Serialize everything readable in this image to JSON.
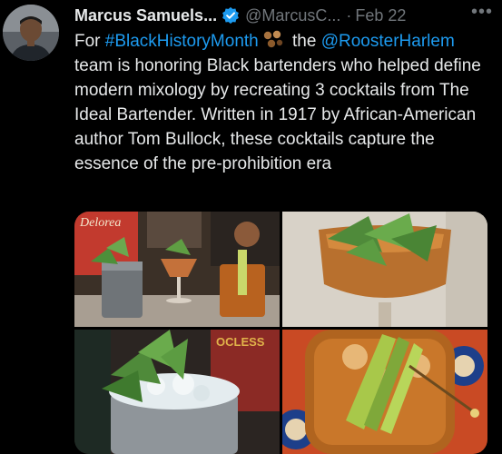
{
  "author": {
    "name": "Marcus Samuels...",
    "handle": "@MarcusC...",
    "separator": "·",
    "date": "Feb 22",
    "more_icon": "more-icon",
    "verified_icon": "verified-icon"
  },
  "tweet": {
    "part1": "For ",
    "hashtag": "#BlackHistoryMonth",
    "emoji": "cocktail-emoji",
    "part2": " the ",
    "mention": "@RoosterHarlem",
    "part3": " team is honoring Black bartenders who helped define modern mixology by recreating 3 cocktails from The Ideal Bartender. Written in 1917 by African-American author Tom Bullock, these cocktails capture the essence of the pre-prohibition era"
  },
  "media": {
    "tile1_sign_text": "Delorea",
    "tile3_sign_text": "OCLESS",
    "colors": {
      "link": "#1d9bf0",
      "secondary": "#71767b",
      "text": "#e7e9ea"
    }
  }
}
